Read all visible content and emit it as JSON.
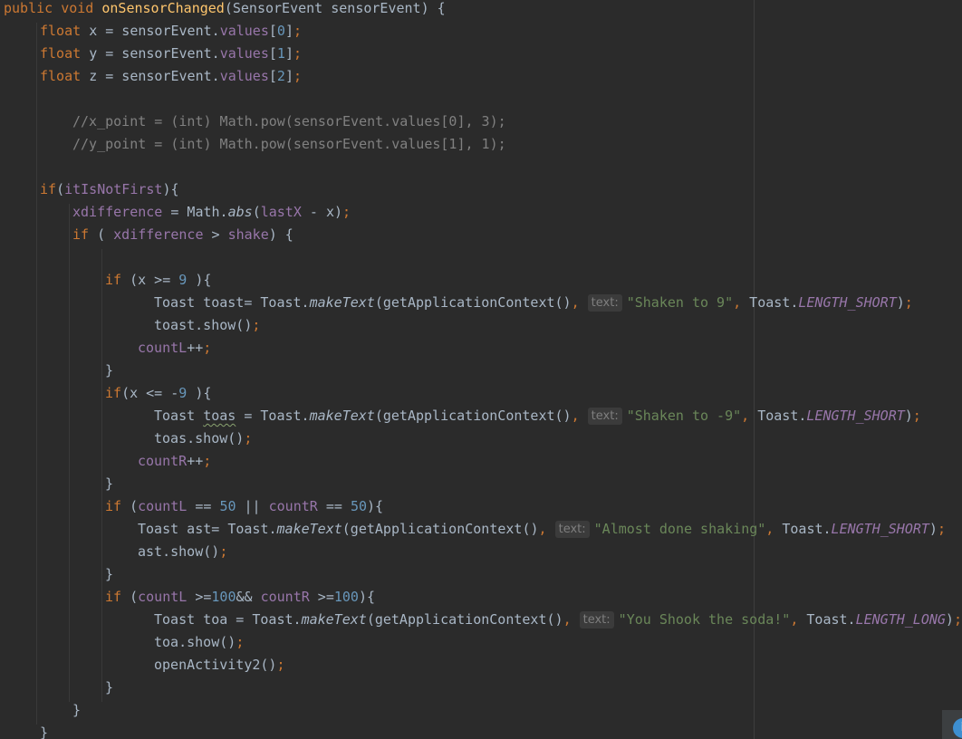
{
  "editor": {
    "lines": [
      {
        "indent": 0,
        "tokens": [
          {
            "t": "public void ",
            "c": "kw"
          },
          {
            "t": "onSensorChanged",
            "c": "fn"
          },
          {
            "t": "(SensorEvent sensorEvent) {",
            "c": ""
          }
        ]
      },
      {
        "indent": 40,
        "tokens": [
          {
            "t": "float ",
            "c": "kw"
          },
          {
            "t": "x = sensorEvent.",
            "c": ""
          },
          {
            "t": "values",
            "c": "field"
          },
          {
            "t": "[",
            "c": ""
          },
          {
            "t": "0",
            "c": "num"
          },
          {
            "t": "]",
            "c": ""
          },
          {
            "t": ";",
            "c": "kw"
          }
        ]
      },
      {
        "indent": 40,
        "tokens": [
          {
            "t": "float ",
            "c": "kw"
          },
          {
            "t": "y = sensorEvent.",
            "c": ""
          },
          {
            "t": "values",
            "c": "field"
          },
          {
            "t": "[",
            "c": ""
          },
          {
            "t": "1",
            "c": "num"
          },
          {
            "t": "]",
            "c": ""
          },
          {
            "t": ";",
            "c": "kw"
          }
        ]
      },
      {
        "indent": 40,
        "tokens": [
          {
            "t": "float ",
            "c": "kw"
          },
          {
            "t": "z = sensorEvent.",
            "c": ""
          },
          {
            "t": "values",
            "c": "field"
          },
          {
            "t": "[",
            "c": ""
          },
          {
            "t": "2",
            "c": "num"
          },
          {
            "t": "]",
            "c": ""
          },
          {
            "t": ";",
            "c": "kw"
          }
        ]
      },
      {
        "indent": 0,
        "tokens": []
      },
      {
        "indent": 76,
        "tokens": [
          {
            "t": "//x_point = (int) Math.pow(sensorEvent.values[0], 3);",
            "c": "comment"
          }
        ]
      },
      {
        "indent": 76,
        "tokens": [
          {
            "t": "//y_point = (int) Math.pow(sensorEvent.values[1], 1);",
            "c": "comment"
          }
        ]
      },
      {
        "indent": 0,
        "tokens": []
      },
      {
        "indent": 40,
        "tokens": [
          {
            "t": "if",
            "c": "kw"
          },
          {
            "t": "(",
            "c": ""
          },
          {
            "t": "itIsNotFirst",
            "c": "field"
          },
          {
            "t": "){",
            "c": ""
          }
        ]
      },
      {
        "indent": 76,
        "tokens": [
          {
            "t": "xdifference",
            "c": "field"
          },
          {
            "t": " = Math.",
            "c": ""
          },
          {
            "t": "abs",
            "c": "italic"
          },
          {
            "t": "(",
            "c": ""
          },
          {
            "t": "lastX",
            "c": "field"
          },
          {
            "t": " - x)",
            "c": ""
          },
          {
            "t": ";",
            "c": "kw"
          }
        ]
      },
      {
        "indent": 76,
        "tokens": [
          {
            "t": "if ",
            "c": "kw"
          },
          {
            "t": "( ",
            "c": ""
          },
          {
            "t": "xdifference",
            "c": "field"
          },
          {
            "t": " > ",
            "c": ""
          },
          {
            "t": "shake",
            "c": "field"
          },
          {
            "t": ") {",
            "c": ""
          }
        ]
      },
      {
        "indent": 0,
        "tokens": []
      },
      {
        "indent": 112,
        "tokens": [
          {
            "t": "if ",
            "c": "kw"
          },
          {
            "t": "(x >= ",
            "c": ""
          },
          {
            "t": "9",
            "c": "num"
          },
          {
            "t": " ){",
            "c": ""
          }
        ]
      },
      {
        "indent": 166,
        "tokens": [
          {
            "t": "Toast toast= Toast.",
            "c": ""
          },
          {
            "t": "makeText",
            "c": "italic"
          },
          {
            "t": "(getApplicationContext()",
            "c": ""
          },
          {
            "t": ", ",
            "c": "kw"
          },
          {
            "t": "text:",
            "c": "hint"
          },
          {
            "t": "\"Shaken to 9\"",
            "c": "str"
          },
          {
            "t": ", ",
            "c": "kw"
          },
          {
            "t": "Toast.",
            "c": ""
          },
          {
            "t": "LENGTH_SHORT",
            "c": "static"
          },
          {
            "t": ")",
            "c": ""
          },
          {
            "t": ";",
            "c": "kw"
          }
        ]
      },
      {
        "indent": 166,
        "tokens": [
          {
            "t": "toast.show()",
            "c": ""
          },
          {
            "t": ";",
            "c": "kw"
          }
        ]
      },
      {
        "indent": 148,
        "tokens": [
          {
            "t": "countL",
            "c": "field"
          },
          {
            "t": "++",
            "c": ""
          },
          {
            "t": ";",
            "c": "kw"
          }
        ]
      },
      {
        "indent": 112,
        "tokens": [
          {
            "t": "}",
            "c": ""
          }
        ]
      },
      {
        "indent": 112,
        "tokens": [
          {
            "t": "if",
            "c": "kw"
          },
          {
            "t": "(x <= -",
            "c": ""
          },
          {
            "t": "9",
            "c": "num"
          },
          {
            "t": " ){",
            "c": ""
          }
        ]
      },
      {
        "indent": 166,
        "tokens": [
          {
            "t": "Toast ",
            "c": ""
          },
          {
            "t": "toas",
            "c": "squiggle"
          },
          {
            "t": " = Toast.",
            "c": ""
          },
          {
            "t": "makeText",
            "c": "italic"
          },
          {
            "t": "(getApplicationContext()",
            "c": ""
          },
          {
            "t": ", ",
            "c": "kw"
          },
          {
            "t": "text:",
            "c": "hint"
          },
          {
            "t": "\"Shaken to -9\"",
            "c": "str"
          },
          {
            "t": ", ",
            "c": "kw"
          },
          {
            "t": "Toast.",
            "c": ""
          },
          {
            "t": "LENGTH_SHORT",
            "c": "static"
          },
          {
            "t": ")",
            "c": ""
          },
          {
            "t": ";",
            "c": "kw"
          }
        ]
      },
      {
        "indent": 166,
        "tokens": [
          {
            "t": "toas.show()",
            "c": ""
          },
          {
            "t": ";",
            "c": "kw"
          }
        ]
      },
      {
        "indent": 148,
        "tokens": [
          {
            "t": "countR",
            "c": "field"
          },
          {
            "t": "++",
            "c": ""
          },
          {
            "t": ";",
            "c": "kw"
          }
        ]
      },
      {
        "indent": 112,
        "tokens": [
          {
            "t": "}",
            "c": ""
          }
        ]
      },
      {
        "indent": 112,
        "tokens": [
          {
            "t": "if ",
            "c": "kw"
          },
          {
            "t": "(",
            "c": ""
          },
          {
            "t": "countL",
            "c": "field"
          },
          {
            "t": " == ",
            "c": ""
          },
          {
            "t": "50",
            "c": "num"
          },
          {
            "t": " || ",
            "c": ""
          },
          {
            "t": "countR",
            "c": "field"
          },
          {
            "t": " == ",
            "c": ""
          },
          {
            "t": "50",
            "c": "num"
          },
          {
            "t": "){",
            "c": ""
          }
        ]
      },
      {
        "indent": 148,
        "tokens": [
          {
            "t": "Toast ast= Toast.",
            "c": ""
          },
          {
            "t": "makeText",
            "c": "italic"
          },
          {
            "t": "(getApplicationContext()",
            "c": ""
          },
          {
            "t": ", ",
            "c": "kw"
          },
          {
            "t": "text:",
            "c": "hint"
          },
          {
            "t": "\"Almost done shaking\"",
            "c": "str"
          },
          {
            "t": ", ",
            "c": "kw"
          },
          {
            "t": "Toast.",
            "c": ""
          },
          {
            "t": "LENGTH_SHORT",
            "c": "static"
          },
          {
            "t": ")",
            "c": ""
          },
          {
            "t": ";",
            "c": "kw"
          }
        ]
      },
      {
        "indent": 148,
        "tokens": [
          {
            "t": "ast.show()",
            "c": ""
          },
          {
            "t": ";",
            "c": "kw"
          }
        ]
      },
      {
        "indent": 112,
        "tokens": [
          {
            "t": "}",
            "c": ""
          }
        ]
      },
      {
        "indent": 112,
        "tokens": [
          {
            "t": "if ",
            "c": "kw"
          },
          {
            "t": "(",
            "c": ""
          },
          {
            "t": "countL",
            "c": "field"
          },
          {
            "t": " >=",
            "c": ""
          },
          {
            "t": "100",
            "c": "num"
          },
          {
            "t": "&& ",
            "c": ""
          },
          {
            "t": "countR",
            "c": "field"
          },
          {
            "t": " >=",
            "c": ""
          },
          {
            "t": "100",
            "c": "num"
          },
          {
            "t": "){",
            "c": ""
          }
        ]
      },
      {
        "indent": 166,
        "tokens": [
          {
            "t": "Toast toa = Toast.",
            "c": ""
          },
          {
            "t": "makeText",
            "c": "italic"
          },
          {
            "t": "(getApplicationContext()",
            "c": ""
          },
          {
            "t": ", ",
            "c": "kw"
          },
          {
            "t": "text:",
            "c": "hint"
          },
          {
            "t": "\"You Shook the soda!\"",
            "c": "str"
          },
          {
            "t": ", ",
            "c": "kw"
          },
          {
            "t": "Toast.",
            "c": ""
          },
          {
            "t": "LENGTH_LONG",
            "c": "static"
          },
          {
            "t": ")",
            "c": ""
          },
          {
            "t": ";",
            "c": "kw"
          }
        ]
      },
      {
        "indent": 166,
        "tokens": [
          {
            "t": "toa.show()",
            "c": ""
          },
          {
            "t": ";",
            "c": "kw"
          }
        ]
      },
      {
        "indent": 166,
        "tokens": [
          {
            "t": "openActivity2()",
            "c": ""
          },
          {
            "t": ";",
            "c": "kw"
          }
        ]
      },
      {
        "indent": 112,
        "tokens": [
          {
            "t": "}",
            "c": ""
          }
        ]
      },
      {
        "indent": 76,
        "tokens": [
          {
            "t": "}",
            "c": ""
          }
        ]
      },
      {
        "indent": 40,
        "tokens": [
          {
            "t": "}",
            "c": ""
          }
        ]
      }
    ]
  },
  "notification": {
    "icon": "info-icon",
    "glyph": "i",
    "color": "#3d8fd1"
  },
  "theme": {
    "background": "#2b2b2b",
    "keyword": "#cc7832",
    "function": "#ffc66d",
    "number": "#6897bb",
    "string": "#6a8759",
    "field": "#9876aa",
    "comment": "#808080",
    "text": "#a9b7c6"
  }
}
